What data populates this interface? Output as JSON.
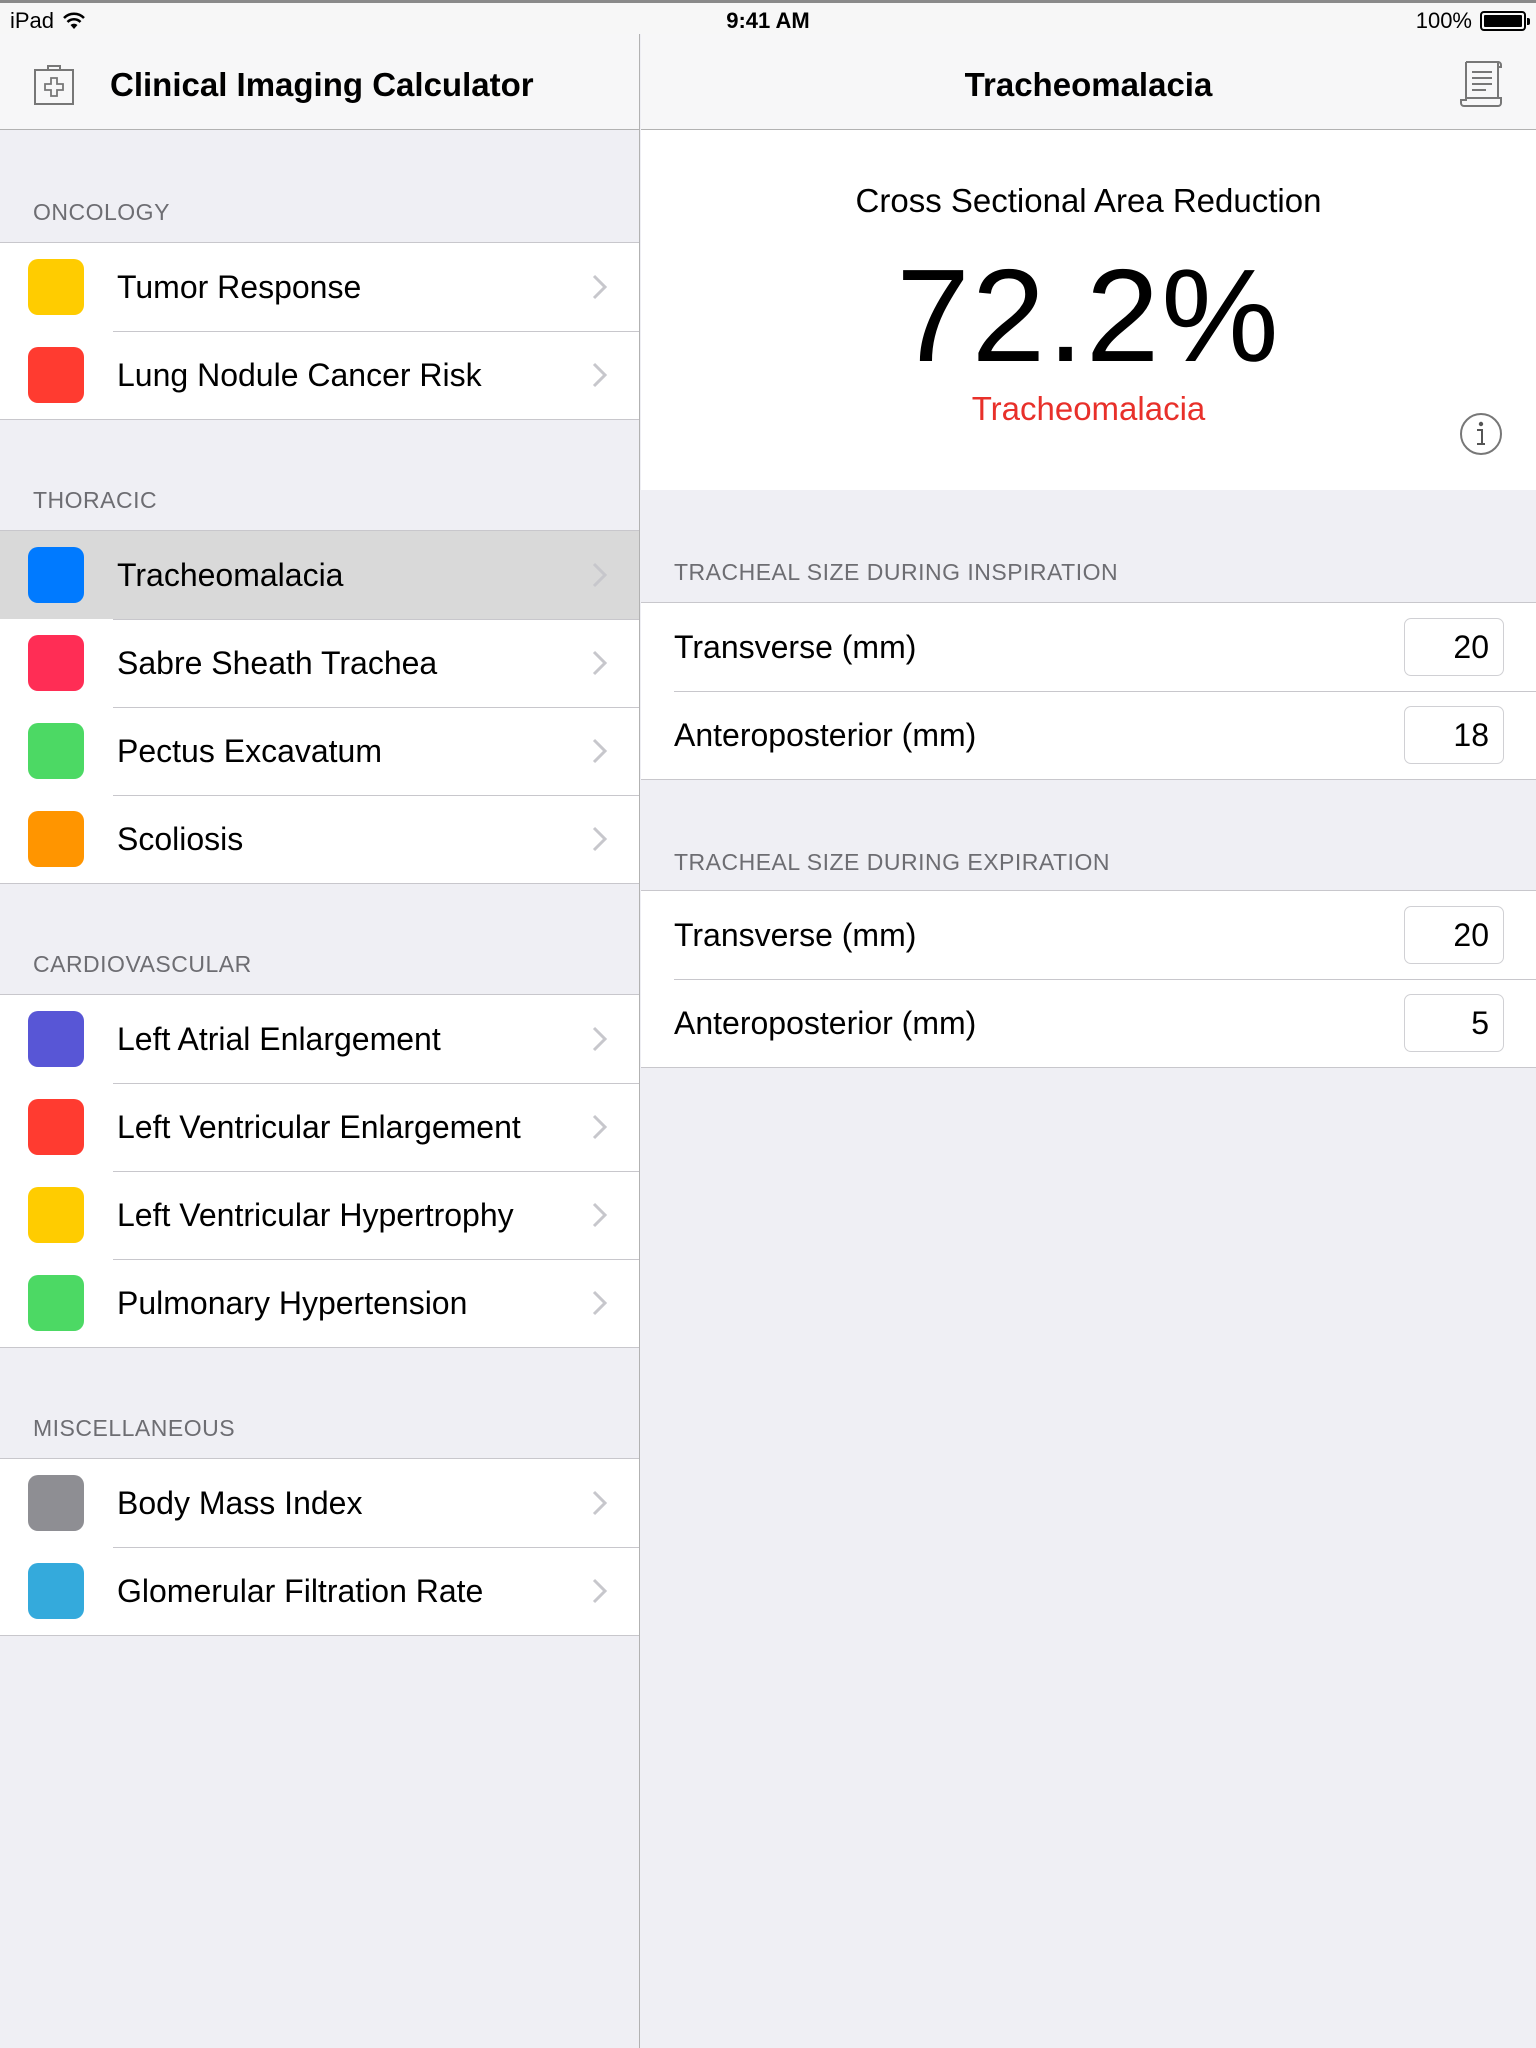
{
  "status_bar": {
    "device": "iPad",
    "time": "9:41 AM",
    "battery": "100%",
    "battery_level": 1.0
  },
  "master": {
    "title": "Clinical Imaging Calculator",
    "icon": "medical-kit-icon",
    "sections": [
      {
        "header": "ONCOLOGY",
        "items": [
          {
            "label": "Tumor Response",
            "color": "#ffcc00"
          },
          {
            "label": "Lung Nodule Cancer Risk",
            "color": "#ff3b30"
          }
        ]
      },
      {
        "header": "THORACIC",
        "items": [
          {
            "label": "Tracheomalacia",
            "color": "#007aff",
            "selected": true
          },
          {
            "label": "Sabre Sheath Trachea",
            "color": "#ff2d55"
          },
          {
            "label": "Pectus Excavatum",
            "color": "#4cd964"
          },
          {
            "label": "Scoliosis",
            "color": "#ff9500"
          }
        ]
      },
      {
        "header": "CARDIOVASCULAR",
        "items": [
          {
            "label": "Left Atrial Enlargement",
            "color": "#5856d6"
          },
          {
            "label": "Left Ventricular Enlargement",
            "color": "#ff3b30"
          },
          {
            "label": "Left Ventricular Hypertrophy",
            "color": "#ffcc00"
          },
          {
            "label": "Pulmonary Hypertension",
            "color": "#4cd964"
          }
        ]
      },
      {
        "header": "MISCELLANEOUS",
        "items": [
          {
            "label": "Body Mass Index",
            "color": "#8e8e93"
          },
          {
            "label": "Glomerular Filtration Rate",
            "color": "#34aadc"
          }
        ]
      }
    ]
  },
  "detail": {
    "title": "Tracheomalacia",
    "icon": "document-scroll-icon",
    "result": {
      "title": "Cross Sectional Area Reduction",
      "value": "72.2%",
      "diagnosis": "Tracheomalacia",
      "diagnosis_color": "#e8302a"
    },
    "sections": [
      {
        "header": "TRACHEAL SIZE DURING INSPIRATION",
        "fields": [
          {
            "label": "Transverse (mm)",
            "value": "20"
          },
          {
            "label": "Anteroposterior (mm)",
            "value": "18"
          }
        ]
      },
      {
        "header": "TRACHEAL SIZE DURING EXPIRATION",
        "fields": [
          {
            "label": "Transverse (mm)",
            "value": "20"
          },
          {
            "label": "Anteroposterior (mm)",
            "value": "5"
          }
        ]
      }
    ]
  }
}
